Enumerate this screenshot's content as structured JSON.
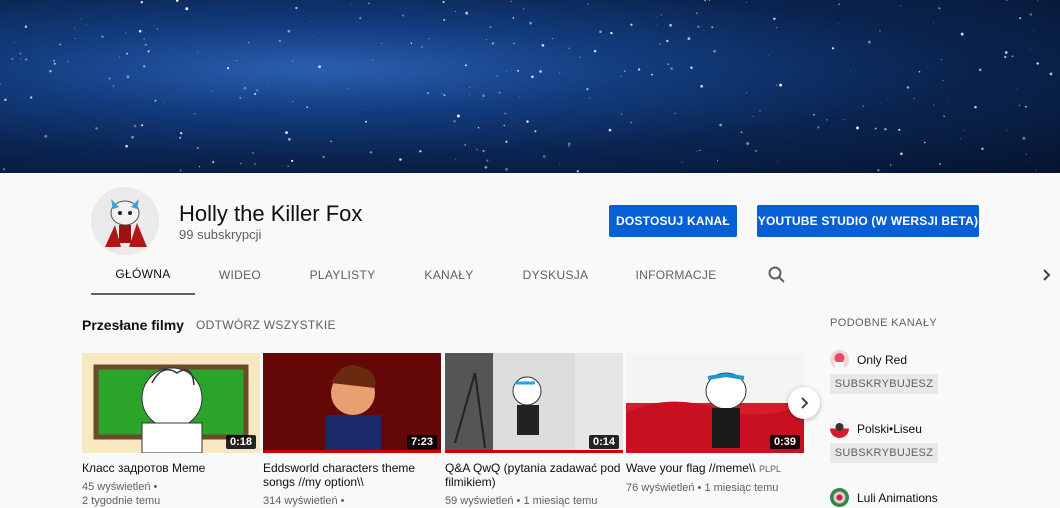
{
  "banner": {
    "description_icon": "starfield-banner"
  },
  "channel": {
    "name": "Holly the Killer Fox",
    "subscribers": "99 subskrypcji",
    "customize_label": "DOSTOSUJ KANAŁ",
    "studio_label": "YOUTUBE STUDIO (W WERSJI BETA)"
  },
  "tabs": [
    {
      "label": "GŁÓWNA",
      "active": true
    },
    {
      "label": "WIDEO"
    },
    {
      "label": "PLAYLISTY"
    },
    {
      "label": "KANAŁY"
    },
    {
      "label": "DYSKUSJA"
    },
    {
      "label": "INFORMACJE"
    }
  ],
  "uploads": {
    "title": "Przesłane filmy",
    "play_all": "ODTWÓRZ WSZYSTKIE",
    "videos": [
      {
        "title": "Класс задротов Meme",
        "duration": "0:18",
        "meta1": "45 wyświetleń •",
        "meta2": "2 tygodnie temu"
      },
      {
        "title": "Eddsworld characters theme songs //my option\\\\",
        "duration": "7:23",
        "meta1": "314 wyświetleń •",
        "meta2": ""
      },
      {
        "title": "Q&A QwQ (pytania zadawać pod filmikiem)",
        "duration": "0:14",
        "meta1": "59 wyświetleń • 1 miesiąc temu",
        "meta2": ""
      },
      {
        "title": "Wave your flag //meme\\\\",
        "title_suffix": "PLPL",
        "duration": "0:39",
        "meta1": "76 wyświetleń • 1 miesiąc temu",
        "meta2": ""
      }
    ]
  },
  "related": {
    "title": "PODOBNE KANAŁY",
    "channels": [
      {
        "name": "Only Red",
        "subscribe": "SUBSKRYBUJESZ"
      },
      {
        "name": "Polski•Liseu",
        "subscribe": "SUBSKRYBUJESZ"
      },
      {
        "name": "Luli Animations"
      }
    ]
  },
  "colors": {
    "accent": "#065fd4",
    "progress": "#cc0000"
  }
}
